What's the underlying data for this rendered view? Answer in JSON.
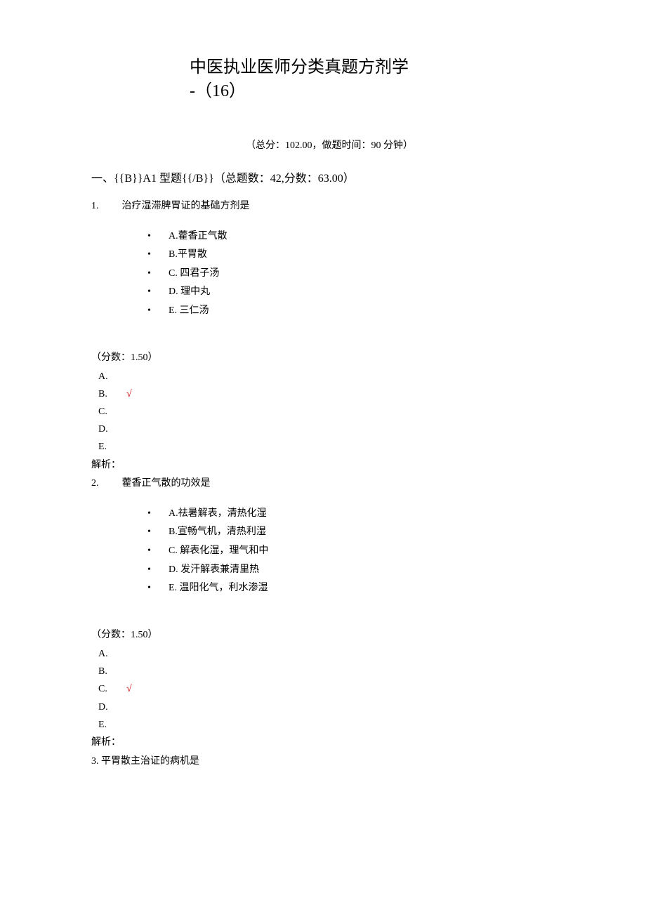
{
  "title": {
    "line1": "中医执业医师分类真题方剂学",
    "line2": "-（16）"
  },
  "meta": "（总分：102.00，做题时间：90 分钟）",
  "section_header": "一、{{B}}A1 型题{{/B}}（总题数：42,分数：63.00）",
  "questions": [
    {
      "num": "1.",
      "stem": "治疗湿滞脾胃证的基础方剂是",
      "options": [
        "A.藿香正气散",
        "B.平胃散",
        "C. 四君子汤",
        "D. 理中丸",
        "E. 三仁汤"
      ],
      "score": "（分数：1.50）",
      "answers": [
        "A.",
        "B.",
        "C.",
        "D.",
        "E."
      ],
      "correct_index": 1,
      "explain": "解析："
    },
    {
      "num": "2.",
      "stem": "藿香正气散的功效是",
      "options": [
        "A.祛暑解表，清热化湿",
        "B.宣畅气机，清热利湿",
        "C. 解表化湿，理气和中",
        "D. 发汗解表兼清里热",
        "E. 温阳化气，利水渗湿"
      ],
      "score": "（分数：1.50）",
      "answers": [
        "A.",
        "B.",
        "C.",
        "D.",
        "E."
      ],
      "correct_index": 2,
      "explain": "解析："
    }
  ],
  "q3": "3. 平胃散主治证的病机是",
  "checkmark": "√"
}
